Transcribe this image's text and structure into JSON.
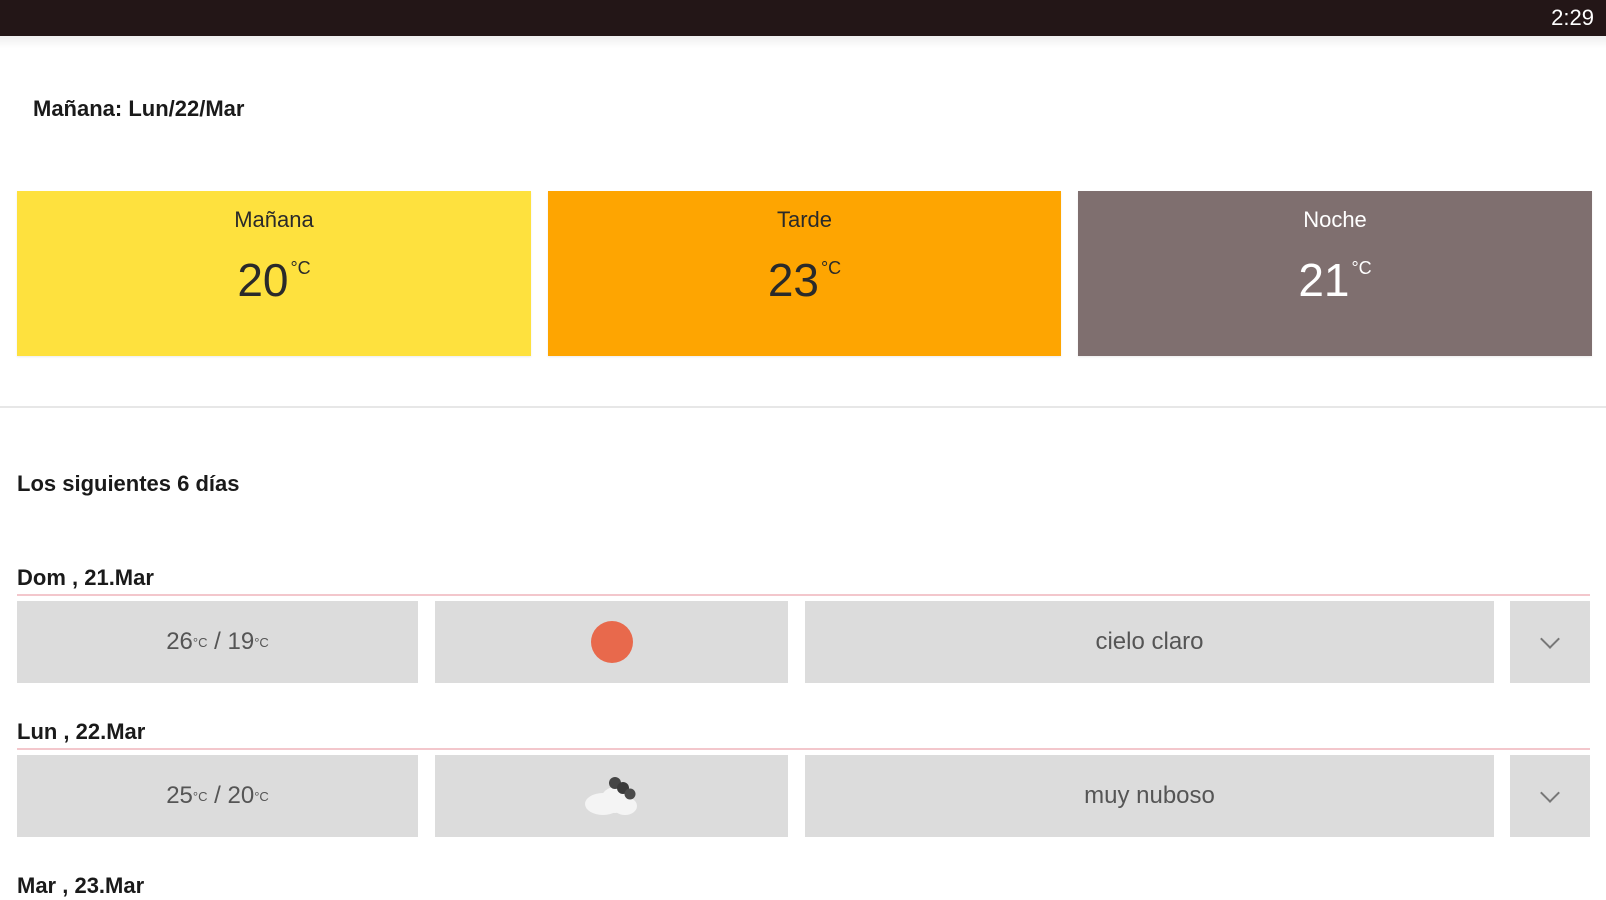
{
  "status": {
    "time": "2:29"
  },
  "tomorrow": {
    "title": "Mañana: Lun/22/Mar",
    "periods": [
      {
        "name": "Mañana",
        "temp": "20",
        "unit": "°C",
        "color": "#FEE13E"
      },
      {
        "name": "Tarde",
        "temp": "23",
        "unit": "°C",
        "color": "#FEA501"
      },
      {
        "name": "Noche",
        "temp": "21",
        "unit": "°C",
        "color": "#7F6F6F"
      }
    ]
  },
  "forecast": {
    "title": "Los siguientes 6 días",
    "days": [
      {
        "label": "Dom , 21.Mar",
        "high": "26",
        "low": "19",
        "unit": "°C",
        "sep": "/",
        "icon": "sun-icon",
        "description": "cielo claro"
      },
      {
        "label": "Lun , 22.Mar",
        "high": "25",
        "low": "20",
        "unit": "°C",
        "sep": "/",
        "icon": "cloud-icon",
        "description": "muy nuboso"
      },
      {
        "label": "Mar , 23.Mar"
      }
    ]
  },
  "colors": {
    "status_bar": "#231617",
    "row_background": "#DCDCDC",
    "row_rule": "#F3C7CC",
    "sun": "#E8694C"
  }
}
